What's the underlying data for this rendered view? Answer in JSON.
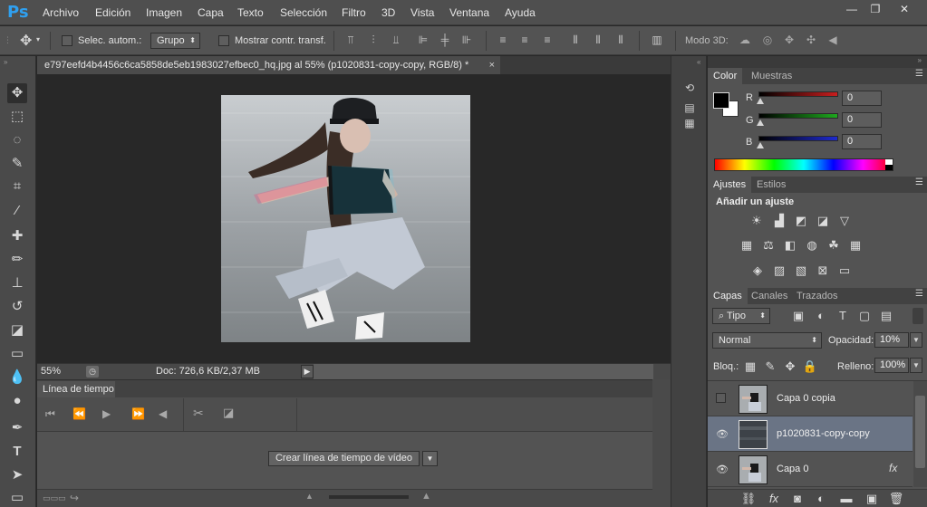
{
  "app": {
    "logo": "Ps"
  },
  "menu": [
    "Archivo",
    "Edición",
    "Imagen",
    "Capa",
    "Texto",
    "Selección",
    "Filtro",
    "3D",
    "Vista",
    "Ventana",
    "Ayuda"
  ],
  "window_controls": {
    "minimize": "—",
    "restore": "❐",
    "close": "✕"
  },
  "options": {
    "auto_select_label": "Selec. autom.:",
    "auto_select_value": "Grupo",
    "show_transform_label": "Mostrar contr. transf.",
    "mode3d_label": "Modo 3D:"
  },
  "document": {
    "tab_title": "e797eefd4b4456c6ca5858de5eb1983027efbec0_hq.jpg al 55% (p1020831-copy-copy, RGB/8) *",
    "zoom": "55%",
    "doc_info": "Doc: 726,6 KB/2,37 MB"
  },
  "timeline": {
    "tab": "Línea de tiempo",
    "create_button": "Crear línea de tiempo de vídeo"
  },
  "color_panel": {
    "tabs": [
      "Color",
      "Muestras"
    ],
    "r_label": "R",
    "g_label": "G",
    "b_label": "B",
    "r_value": "0",
    "g_value": "0",
    "b_value": "0",
    "r_color": "#c81e1e",
    "g_color": "#1ea81e",
    "b_color": "#1e2ad0"
  },
  "adjustments_panel": {
    "tabs": [
      "Ajustes",
      "Estilos"
    ],
    "heading": "Añadir un ajuste"
  },
  "layers_panel": {
    "tabs": [
      "Capas",
      "Canales",
      "Trazados"
    ],
    "filter_value": "Tipo",
    "blend_mode": "Normal",
    "opacity_label": "Opacidad:",
    "opacity_value": "10%",
    "lock_label": "Bloq.:",
    "fill_label": "Relleno:",
    "fill_value": "100%",
    "layers": [
      {
        "name": "Capa 0 copia",
        "visible": false,
        "selected": false
      },
      {
        "name": "p1020831-copy-copy",
        "visible": true,
        "selected": true
      },
      {
        "name": "Capa 0",
        "visible": true,
        "selected": false,
        "fx": "fx"
      }
    ]
  }
}
